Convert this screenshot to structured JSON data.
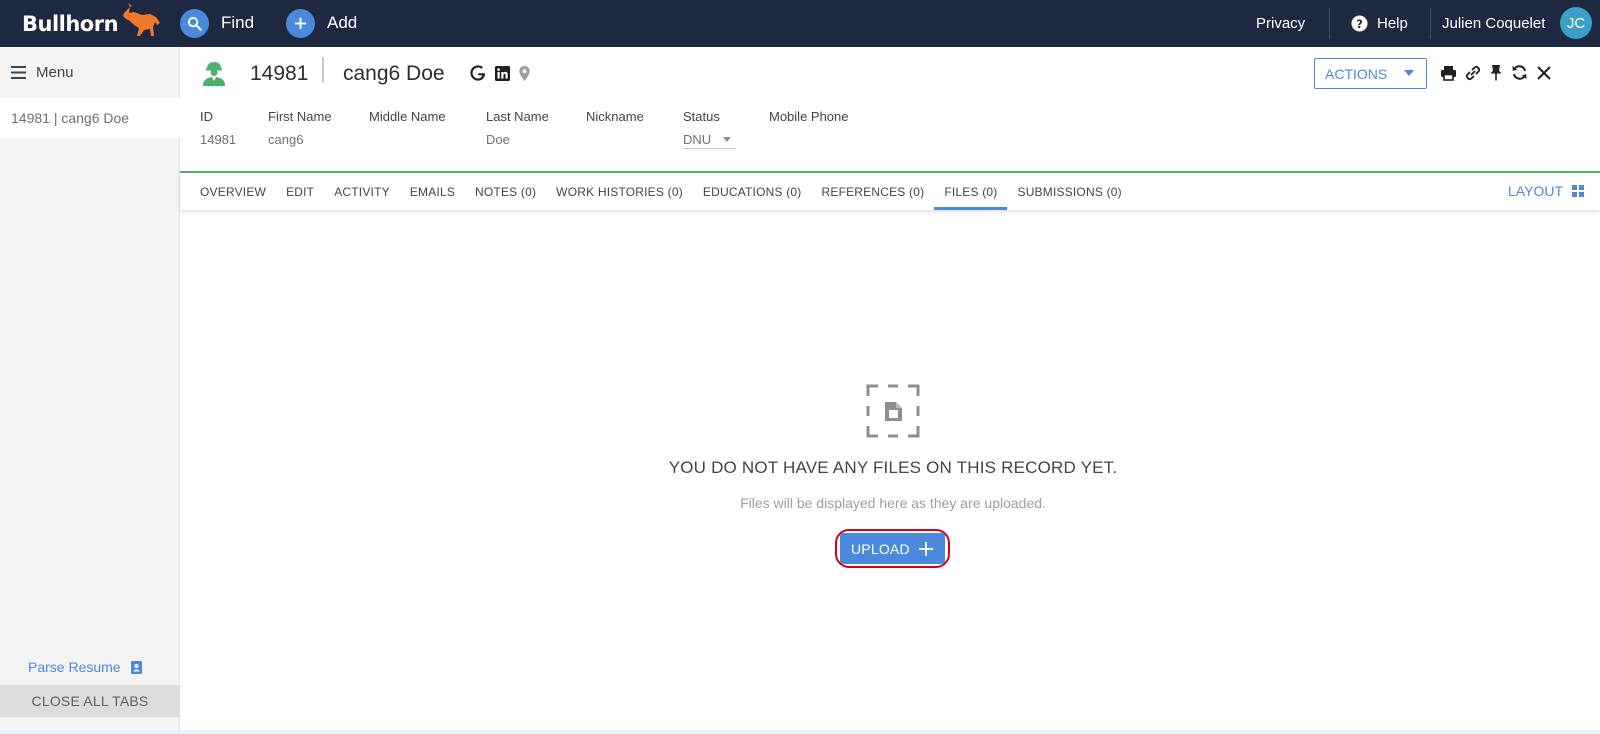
{
  "topbar": {
    "logo_text": "Bullhorn",
    "find_label": "Find",
    "add_label": "Add",
    "privacy_label": "Privacy",
    "help_label": "Help",
    "user_name": "Julien Coquelet",
    "user_initials": "JC"
  },
  "sidebar": {
    "menu_label": "Menu",
    "open_tab_label": "14981 | cang6 Doe",
    "parse_resume_label": "Parse Resume",
    "close_all_label": "CLOSE ALL TABS"
  },
  "record": {
    "id": "14981",
    "name": "cang6 Doe",
    "actions_label": "ACTIONS",
    "fields": {
      "id_label": "ID",
      "id_value": "14981",
      "first_name_label": "First Name",
      "first_name_value": "cang6",
      "middle_name_label": "Middle Name",
      "middle_name_value": "",
      "last_name_label": "Last Name",
      "last_name_value": "Doe",
      "nickname_label": "Nickname",
      "nickname_value": "",
      "status_label": "Status",
      "status_value": "DNU",
      "mobile_phone_label": "Mobile Phone",
      "mobile_phone_value": ""
    }
  },
  "tabs": [
    {
      "label": "OVERVIEW"
    },
    {
      "label": "EDIT"
    },
    {
      "label": "ACTIVITY"
    },
    {
      "label": "EMAILS"
    },
    {
      "label": "NOTES (0)"
    },
    {
      "label": "WORK HISTORIES (0)"
    },
    {
      "label": "EDUCATIONS (0)"
    },
    {
      "label": "REFERENCES (0)"
    },
    {
      "label": "FILES (0)"
    },
    {
      "label": "SUBMISSIONS (0)"
    }
  ],
  "active_tab": "FILES (0)",
  "layout_label": "LAYOUT",
  "empty_state": {
    "title": "YOU DO NOT HAVE ANY FILES ON THIS RECORD YET.",
    "subtitle": "Files will be displayed here as they are uploaded.",
    "upload_label": "UPLOAD"
  },
  "colors": {
    "topbar_bg": "#1e2841",
    "accent_blue": "#4a89dc",
    "brand_orange": "#f0792a",
    "candidate_green": "#4cb06a",
    "highlight_red": "#d0021b",
    "avatar_bg": "#3aa0c9"
  },
  "icons": {
    "find": "search-icon",
    "add": "plus-icon",
    "help": "question-circle-icon",
    "menu": "hamburger-icon",
    "candidate": "person-icon",
    "google": "google-icon",
    "linkedin": "linkedin-icon",
    "location": "map-pin-icon",
    "print": "printer-icon",
    "link": "link-icon",
    "pin": "pushpin-icon",
    "refresh": "refresh-icon",
    "close": "close-icon",
    "layout": "grid-icon",
    "empty_files": "file-placeholder-icon",
    "parse_resume": "resume-icon"
  }
}
